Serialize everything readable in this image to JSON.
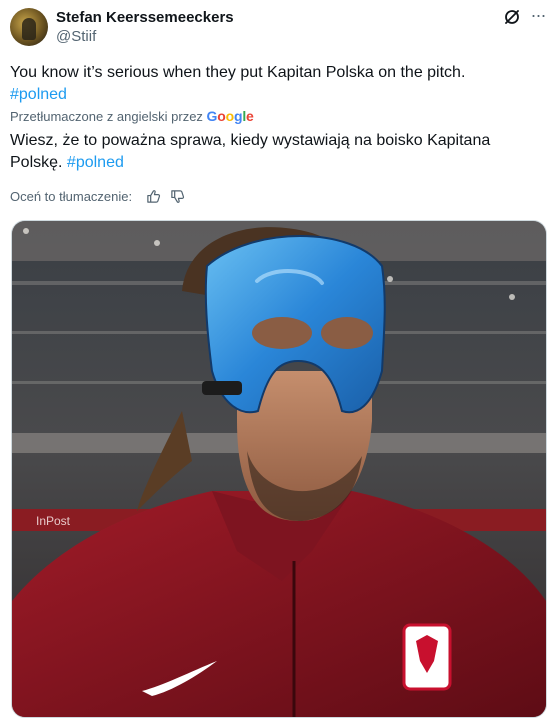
{
  "author": {
    "display_name": "Stefan Keerssemeeckers",
    "handle": "@Stiif"
  },
  "tweet": {
    "text_main": "You know it’s serious when they put Kapitan Polska on the pitch.",
    "hashtag": "#polned",
    "translated_label": "Przetłumaczone z angielski przez",
    "google_letters": [
      "G",
      "o",
      "o",
      "g",
      "l",
      "e"
    ],
    "translation_main": "Wiesz, że to poważna sprawa, kiedy wystawiają na boisko Kapitana Polskę.",
    "rate_label": "Oceń to tłumaczenie:"
  },
  "icons": {
    "grok": "grok-icon",
    "more": "more-icon",
    "thumb_up": "thumb-up-icon",
    "thumb_down": "thumb-down-icon",
    "more_glyph": "···"
  },
  "image": {
    "board_text_left": "InPost"
  },
  "colors": {
    "link": "#1d9bf0",
    "secondary": "#536471",
    "jersey": "#8a1420",
    "mask": "#2a86d8"
  }
}
